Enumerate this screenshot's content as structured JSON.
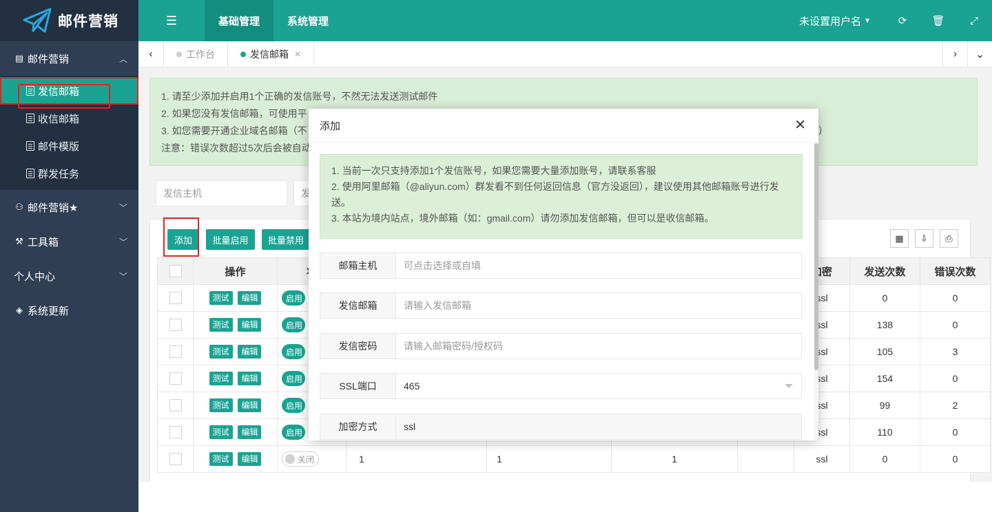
{
  "app": {
    "title": "邮件营销"
  },
  "sidebar": {
    "groups": [
      {
        "label": "邮件营销",
        "icon": "document-icon",
        "expanded": true,
        "items": [
          {
            "label": "发信邮箱",
            "active": true
          },
          {
            "label": "收信邮箱"
          },
          {
            "label": "邮件模版"
          },
          {
            "label": "群发任务"
          }
        ]
      },
      {
        "label": "邮件营销★",
        "icon": "users-icon"
      },
      {
        "label": "工具箱",
        "icon": "tools-icon"
      },
      {
        "label": "个人中心",
        "icon": ""
      },
      {
        "label": "系统更新",
        "icon": "layers-icon"
      }
    ]
  },
  "topbar": {
    "tabs": [
      "基础管理",
      "系统管理"
    ],
    "active_tab": "基础管理",
    "user": "未设置用户名"
  },
  "page_tabs": [
    {
      "label": "工作台",
      "active": false
    },
    {
      "label": "发信邮箱",
      "active": true
    }
  ],
  "notice": {
    "lines": [
      "1. 请至少添加并启用1个正确的发信账号，不然无法发送测试邮件",
      "2. 如果您没有发信邮箱，可使用平",
      "3. 如您需要开通企业域名邮箱（不",
      "注意：错误次数超过5次后会被自动"
    ],
    "line3_tail": "用号）"
  },
  "filters": {
    "host_placeholder": "发信主机",
    "second_placeholder": "发"
  },
  "toolbar": {
    "add": "添加",
    "batch_enable": "批量启用",
    "batch_disable": "批量禁用"
  },
  "table": {
    "headers": [
      "操作",
      "状",
      "加密",
      "发送次数",
      "错误次数"
    ],
    "test_label": "测试",
    "edit_label": "编辑",
    "on_label": "启用",
    "off_label": "关闭",
    "rows": [
      {
        "enc": "ssl",
        "sent": "0",
        "err": "0",
        "on": true
      },
      {
        "enc": "ssl",
        "sent": "138",
        "err": "0",
        "on": true
      },
      {
        "enc": "ssl",
        "sent": "105",
        "err": "3",
        "on": true
      },
      {
        "enc": "ssl",
        "sent": "154",
        "err": "0",
        "on": true
      },
      {
        "enc": "ssl",
        "sent": "99",
        "err": "2",
        "on": true
      },
      {
        "enc": "ssl",
        "sent": "110",
        "err": "0",
        "on": true
      },
      {
        "enc": "ssl",
        "sent": "0",
        "err": "0",
        "on": false,
        "c1": "1",
        "c2": "1",
        "c3": "1"
      }
    ]
  },
  "modal": {
    "title": "添加",
    "notice_lines": [
      "1. 当前一次只支持添加1个发信账号，如果您需要大量添加账号，请联系客服",
      "2. 使用阿里邮箱（@aliyun.com）群发看不到任何返回信息（官方没返回），建议使用其他邮箱账号进行发送。",
      "3. 本站为境内站点，境外邮箱（如：gmail.com）请勿添加发信邮箱，但可以是收信邮箱。"
    ],
    "fields": [
      {
        "label": "邮箱主机",
        "placeholder": "可点击选择或自填"
      },
      {
        "label": "发信邮箱",
        "placeholder": "请输入发信邮箱"
      },
      {
        "label": "发信密码",
        "placeholder": "请输入邮箱密码/授权码"
      },
      {
        "label": "SSL端口",
        "value": "465"
      },
      {
        "label": "加密方式",
        "value": "ssl"
      }
    ]
  },
  "colors": {
    "primary": "#1aa393",
    "sidebar": "#2f3e52",
    "highlight": "#e0251f"
  }
}
